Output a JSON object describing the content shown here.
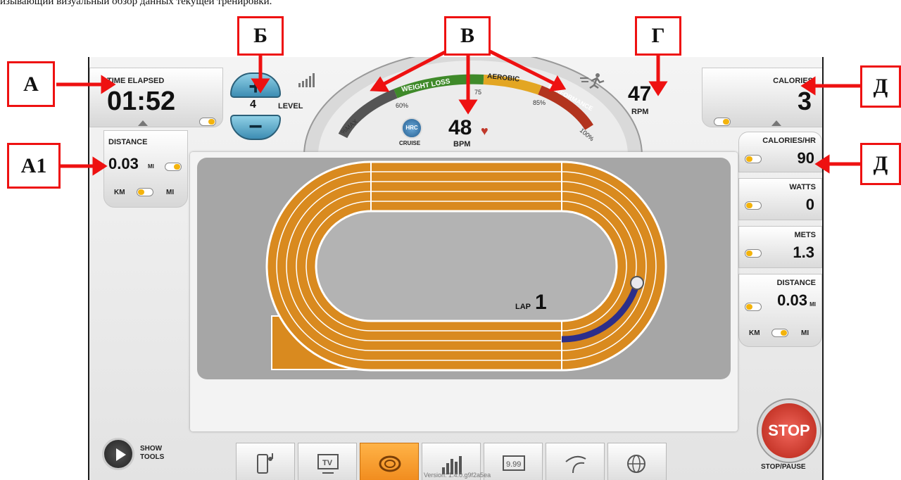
{
  "caption": "изывающий визуальный обзор данных текущей тренировки.",
  "callouts": {
    "a": "А",
    "a1": "А1",
    "b": "Б",
    "v": "В",
    "g": "Г",
    "d1": "Д",
    "d2": "Д"
  },
  "time": {
    "label": "TIME ELAPSED",
    "value": "01:52"
  },
  "distance_left": {
    "label": "DISTANCE",
    "value": "0.03",
    "unit": "MI",
    "km": "KM",
    "mi": "MI"
  },
  "level": {
    "value": "4",
    "label": "LEVEL"
  },
  "hr_gauge": {
    "zones": [
      "WEIGHT LOSS",
      "AEROBIC",
      "PERFORMANCE"
    ],
    "ticks": [
      "%MAX",
      "60%",
      "75",
      "85%",
      "100%"
    ],
    "hrc_badge": "HRC",
    "cruise": "CRUISE",
    "bpm_value": "48",
    "bpm_label": "BPM",
    "zone_colors": [
      "#555555",
      "#3f8a2a",
      "#e3a623",
      "#b2341e"
    ]
  },
  "rpm": {
    "value": "47",
    "label": "RPM"
  },
  "calories": {
    "label": "CALORIES",
    "value": "3"
  },
  "stats": [
    {
      "label": "CALORIES/HR",
      "value": "90"
    },
    {
      "label": "WATTS",
      "value": "0"
    },
    {
      "label": "METS",
      "value": "1.3"
    },
    {
      "label": "DISTANCE",
      "value": "0.03",
      "unit": "MI"
    }
  ],
  "unit_toggle_right": {
    "km": "KM",
    "mi": "MI"
  },
  "track": {
    "lap_label": "LAP",
    "lap_value": "1",
    "progress_fraction": 0.08,
    "track_color": "#d98a1f"
  },
  "toolbar": [
    "phone-music-icon",
    "tv-icon",
    "track-view-icon",
    "bar-chart-icon",
    "scoreboard-icon",
    "route-icon",
    "www-icon"
  ],
  "show_tools": "SHOW TOOLS",
  "stop": {
    "label": "STOP",
    "caption": "STOP/PAUSE"
  },
  "version": "Version: 1.4.0.g9f2a5ea"
}
